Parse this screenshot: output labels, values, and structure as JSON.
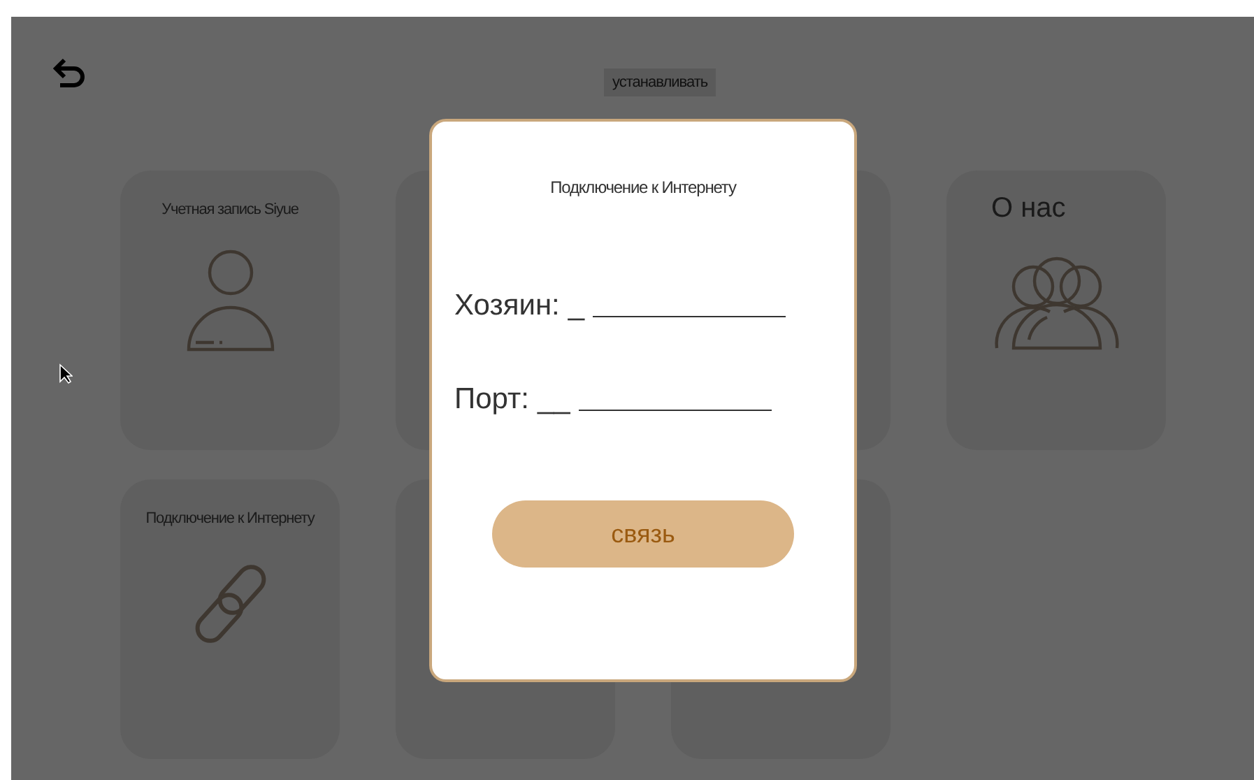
{
  "header": {
    "title": "устанавливать"
  },
  "tiles": [
    {
      "label": "Учетная запись Siyue"
    },
    {
      "label": "О нас"
    },
    {
      "label": "Подключение к Интернету"
    }
  ],
  "dialog": {
    "title": "Подключение к Интернету",
    "fields": [
      {
        "label": "Хозяин:",
        "value": "_"
      },
      {
        "label": "Порт:",
        "value": "__"
      }
    ],
    "button": "связь"
  }
}
